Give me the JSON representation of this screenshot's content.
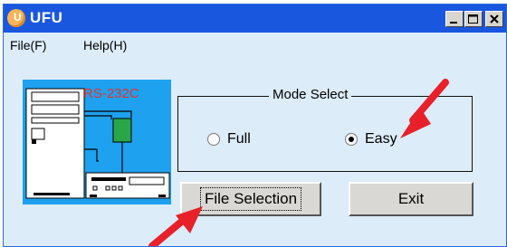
{
  "window": {
    "title": "UFU",
    "controls": [
      "minimize",
      "maximize",
      "close"
    ]
  },
  "menu": {
    "items": [
      "File(F)",
      "Help(H)"
    ]
  },
  "diagram": {
    "label": "RS-232C"
  },
  "mode_select": {
    "legend": "Mode Select",
    "options": [
      {
        "label": "Full",
        "selected": false
      },
      {
        "label": "Easy",
        "selected": true
      }
    ]
  },
  "buttons": {
    "file_selection": "File Selection",
    "exit": "Exit"
  },
  "colors": {
    "titlebar": "#1a57df",
    "window_bg": "#dcecf9",
    "diagram_bg": "#1ea1ee",
    "diagram_label": "#e8322b",
    "arrow": "#e8202a",
    "module": "#2aa64a"
  }
}
